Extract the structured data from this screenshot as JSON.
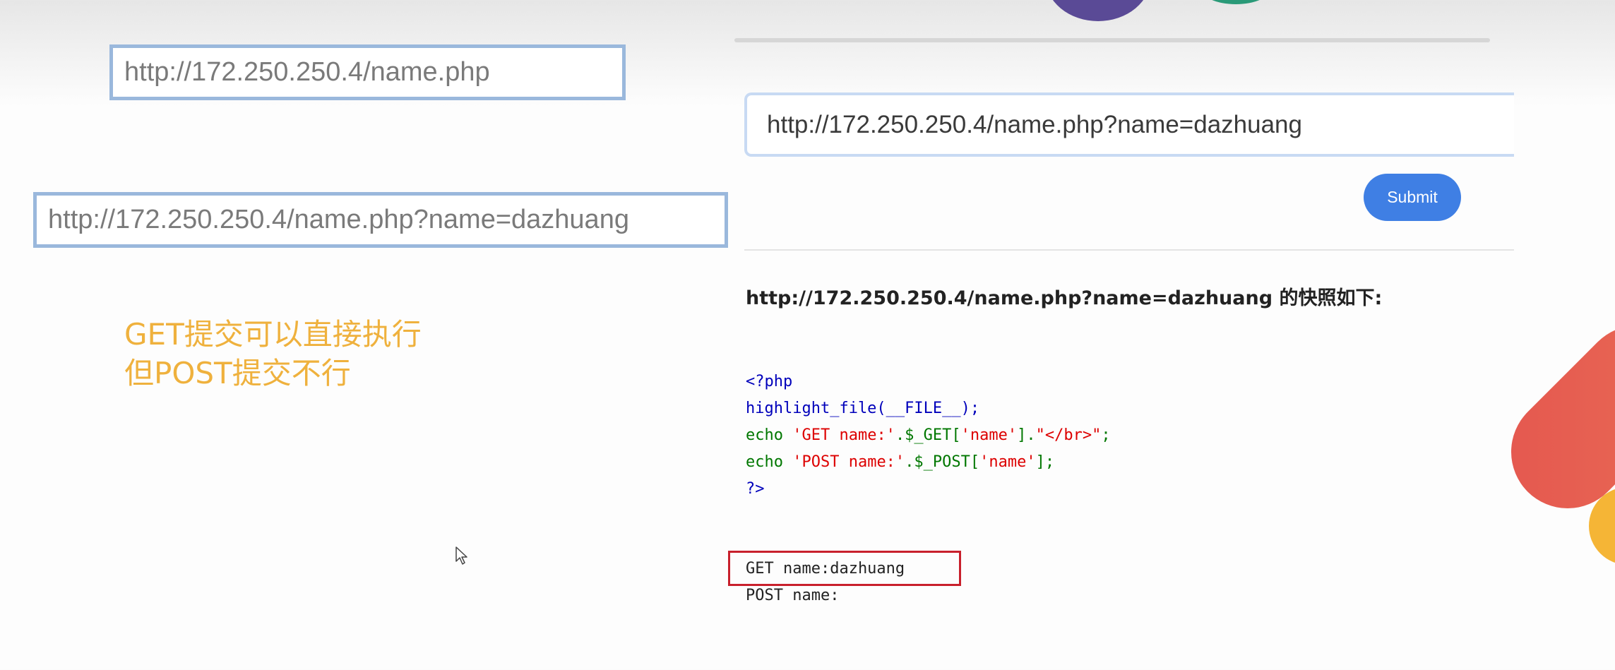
{
  "left": {
    "url_plain": "http://172.250.250.4/name.php",
    "url_query": "http://172.250.250.4/name.php?name=dazhuang",
    "note_line1": "GET提交可以直接执行",
    "note_line2": "但POST提交不行"
  },
  "right": {
    "address_value": "http://172.250.250.4/name.php?name=dazhuang",
    "submit_label": "Submit",
    "snapshot_heading": "http://172.250.250.4/name.php?name=dazhuang 的快照如下:",
    "code": {
      "line1": "<?php",
      "line2": "highlight_file(__FILE__);",
      "line3_echo": "echo ",
      "line3_str1": "'GET name:'",
      "line3_op1": ".$_GET[",
      "line3_str2": "'name'",
      "line3_op2": "].",
      "line3_str3": "\"</br>\"",
      "line3_end": ";",
      "line4_echo": "echo ",
      "line4_str1": "'POST name:'",
      "line4_op1": ".$_POST[",
      "line4_str2": "'name'",
      "line4_end": "];",
      "line5": "?>"
    },
    "output_get": "GET name:dazhuang",
    "output_post": "POST name:"
  },
  "colors": {
    "accent": "#3f7fe4",
    "note_text": "#efb13d",
    "highlight_box": "#c8202c"
  }
}
